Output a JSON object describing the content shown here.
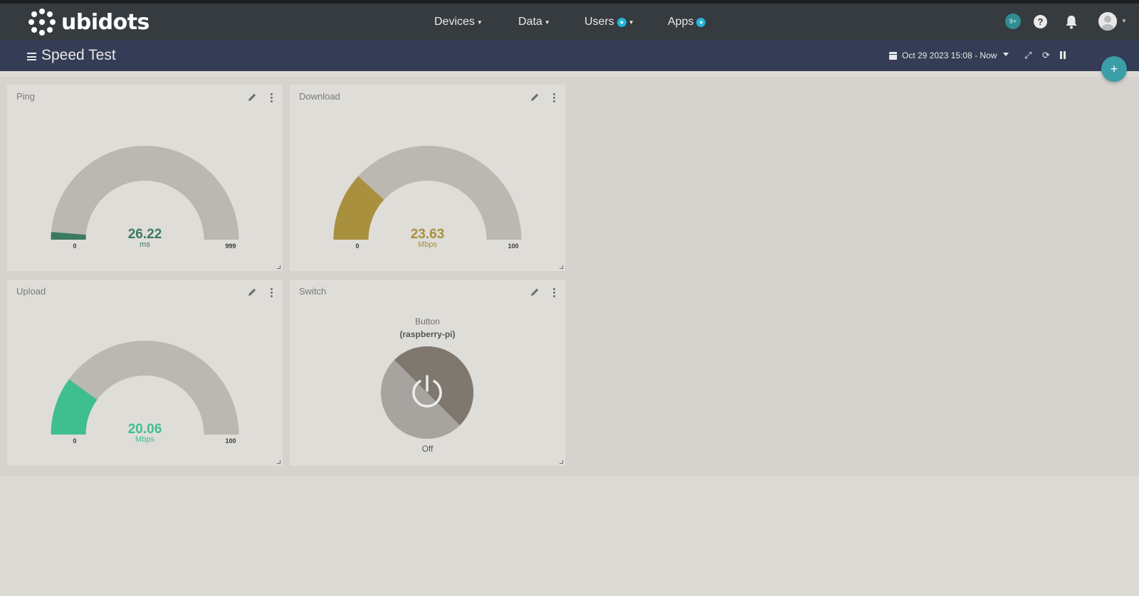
{
  "app": {
    "brand": "ubidots"
  },
  "nav": {
    "devices": "Devices",
    "data": "Data",
    "users": "Users",
    "apps": "Apps"
  },
  "header": {
    "notifications_count": "9+",
    "help": "?"
  },
  "dashboard": {
    "title": "Speed Test",
    "date_range": "Oct 29 2023 15:08 - Now",
    "add_label": "+"
  },
  "widgets": {
    "ping": {
      "title": "Ping",
      "value": "26.22",
      "unit": "ms",
      "min": "0",
      "max": "999",
      "numeric": 26.22,
      "range": [
        0,
        999
      ],
      "color": "#3b7a62"
    },
    "download": {
      "title": "Download",
      "value": "23.63",
      "unit": "Mbps",
      "min": "0",
      "max": "100",
      "numeric": 23.63,
      "range": [
        0,
        100
      ],
      "color": "#a9903e"
    },
    "upload": {
      "title": "Upload",
      "value": "20.06",
      "unit": "Mbps",
      "min": "0",
      "max": "100",
      "numeric": 20.06,
      "range": [
        0,
        100
      ],
      "color": "#3fbf8f"
    },
    "switch": {
      "title": "Switch",
      "label": "Button",
      "device": "(raspberry-pi)",
      "state": "Off"
    }
  },
  "colors": {
    "topbar": "#363b3f",
    "subbar": "#343d55",
    "gauge_track": "#bbb8b1",
    "accent": "#3a9ea6"
  }
}
